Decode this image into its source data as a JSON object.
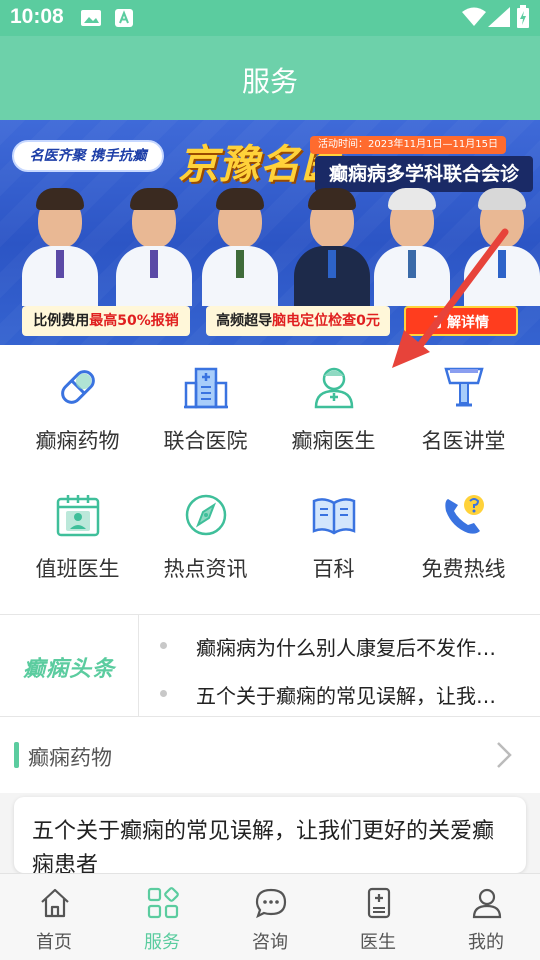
{
  "status_bar": {
    "time": "10:08",
    "icons": [
      "image-icon",
      "a-notification-icon",
      "wifi-icon",
      "signal-icon",
      "battery-icon"
    ]
  },
  "header": {
    "title": "服务"
  },
  "banner": {
    "tag": "名医齐聚 携手抗癫",
    "brand": "京豫名医",
    "activity_time": "活动时间：2023年11月1日—11月15日",
    "subtitle": "癫痫病多学科联合会诊",
    "promo_a": {
      "prefix": "比例费用",
      "highlight": "最高50%报销"
    },
    "promo_b": {
      "prefix": "高频超导",
      "highlight": "脑电定位检查0元"
    },
    "promo_c": "了解详情",
    "colors": {
      "bg": "#2c55c5",
      "brand": "#ffd23a",
      "cta": "#ff3d1e"
    }
  },
  "grid": [
    {
      "label": "癫痫药物",
      "icon": "pill-capsule-icon"
    },
    {
      "label": "联合医院",
      "icon": "hospital-icon"
    },
    {
      "label": "癫痫医生",
      "icon": "doctor-icon"
    },
    {
      "label": "名医讲堂",
      "icon": "lectern-icon"
    },
    {
      "label": "值班医生",
      "icon": "duty-calendar-icon"
    },
    {
      "label": "热点资讯",
      "icon": "compass-icon"
    },
    {
      "label": "百科",
      "icon": "open-book-icon"
    },
    {
      "label": "免费热线",
      "icon": "phone-call-icon"
    }
  ],
  "headline": {
    "logo_text": "癫痫头条",
    "items": [
      "癫痫病为什么别人康复后不发作…",
      "五个关于癫痫的常见误解，让我…"
    ]
  },
  "section": {
    "title": "癫痫药物"
  },
  "article": {
    "title": "五个关于癫痫的常见误解，让我们更好的关爱癫痫患者"
  },
  "bottom_nav": [
    {
      "label": "首页",
      "icon": "home-icon",
      "active": false
    },
    {
      "label": "服务",
      "icon": "services-grid-icon",
      "active": true
    },
    {
      "label": "咨询",
      "icon": "chat-bubble-icon",
      "active": false
    },
    {
      "label": "医生",
      "icon": "doctor-badge-icon",
      "active": false
    },
    {
      "label": "我的",
      "icon": "user-icon",
      "active": false
    }
  ],
  "colors": {
    "accent": "#5bcc9f",
    "header": "#6dd1aa",
    "icon_blue": "#3a73e0",
    "icon_green": "#3fbf9a"
  }
}
